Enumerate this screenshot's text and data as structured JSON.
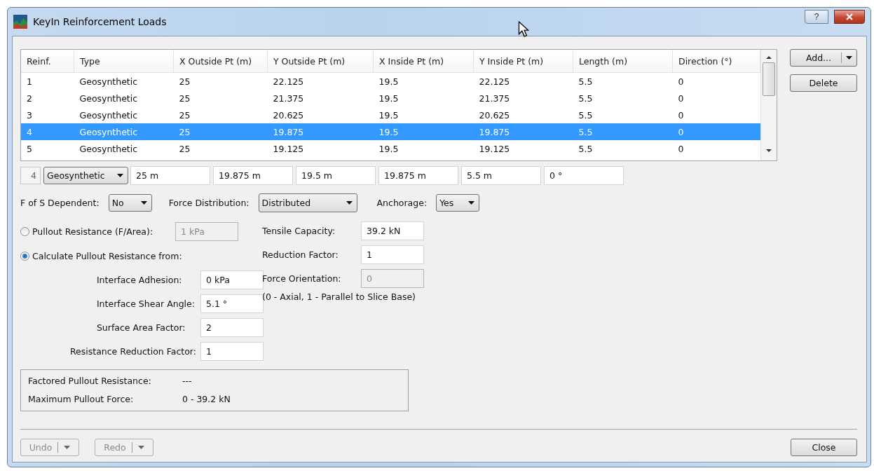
{
  "window": {
    "title": "KeyIn Reinforcement Loads",
    "help": "?"
  },
  "table": {
    "columns": [
      "Reinf.",
      "Type",
      "X Outside Pt (m)",
      "Y Outside Pt (m)",
      "X Inside Pt (m)",
      "Y Inside Pt (m)",
      "Length (m)",
      "Direction (°)"
    ],
    "rows": [
      {
        "cells": [
          "1",
          "Geosynthetic",
          "25",
          "22.125",
          "19.5",
          "22.125",
          "5.5",
          "0"
        ],
        "selected": false
      },
      {
        "cells": [
          "2",
          "Geosynthetic",
          "25",
          "21.375",
          "19.5",
          "21.375",
          "5.5",
          "0"
        ],
        "selected": false
      },
      {
        "cells": [
          "3",
          "Geosynthetic",
          "25",
          "20.625",
          "19.5",
          "20.625",
          "5.5",
          "0"
        ],
        "selected": false
      },
      {
        "cells": [
          "4",
          "Geosynthetic",
          "25",
          "19.875",
          "19.5",
          "19.875",
          "5.5",
          "0"
        ],
        "selected": true
      },
      {
        "cells": [
          "5",
          "Geosynthetic",
          "25",
          "19.125",
          "19.5",
          "19.125",
          "5.5",
          "0"
        ],
        "selected": false
      }
    ]
  },
  "editor": {
    "index": "4",
    "type": "Geosynthetic",
    "fields": [
      "25 m",
      "19.875 m",
      "19.5 m",
      "19.875 m",
      "5.5 m",
      "0 °"
    ]
  },
  "dropdowns": [
    {
      "label": "F of S Dependent:",
      "value": "No"
    },
    {
      "label": "Force Distribution:",
      "value": "Distributed"
    },
    {
      "label": "Anchorage:",
      "value": "Yes"
    }
  ],
  "pullout": {
    "value_option": {
      "label": "Pullout Resistance (F/Area):",
      "selected": false,
      "value": "1 kPa",
      "disabled": true
    },
    "calc_option": {
      "label": "Calculate Pullout Resistance from:",
      "selected": true
    },
    "calc_fields": [
      {
        "label": "Interface Adhesion:",
        "value": "0 kPa"
      },
      {
        "label": "Interface Shear Angle:",
        "value": "5.1 °"
      },
      {
        "label": "Surface Area Factor:",
        "value": "2"
      },
      {
        "label": "Resistance Reduction Factor:",
        "value": "1"
      }
    ]
  },
  "right_fields": [
    {
      "label": "Tensile Capacity:",
      "value": "39.2 kN",
      "disabled": false
    },
    {
      "label": "Reduction Factor:",
      "value": "1",
      "disabled": false
    },
    {
      "label": "Force Orientation:",
      "value": "0",
      "disabled": true
    }
  ],
  "note": "(0 - Axial, 1 - Parallel to Slice Base)",
  "results": [
    {
      "label": "Factored Pullout Resistance:",
      "value": "---"
    },
    {
      "label": "Maximum Pullout Force:",
      "value": "0 - 39.2 kN"
    }
  ],
  "side_buttons": {
    "add": "Add...",
    "delete": "Delete"
  },
  "bottom_buttons": [
    {
      "label": "Undo",
      "disabled": true
    },
    {
      "label": "Redo",
      "disabled": true
    }
  ],
  "close_button": "Close"
}
